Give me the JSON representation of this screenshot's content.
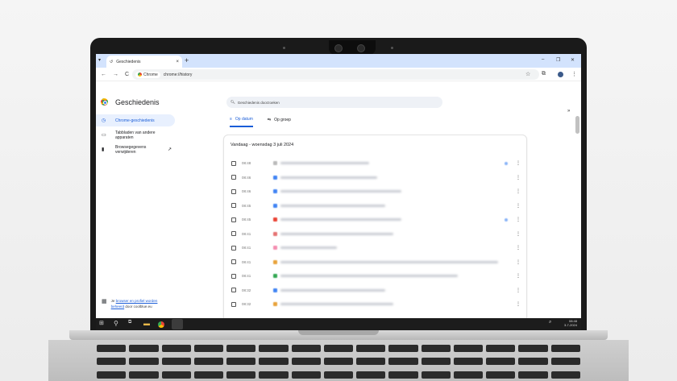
{
  "browser": {
    "tab_title": "Geschiedenis",
    "tab_icon": "history-icon",
    "new_tab": "+",
    "url_chip": "Chrome",
    "url": "chrome://history"
  },
  "sidebar": {
    "title": "Geschiedenis",
    "items": [
      {
        "label": "Chrome-geschiedenis",
        "icon": "history-icon",
        "active": true
      },
      {
        "label": "Tabbladen van andere apparaten",
        "icon": "devices-icon",
        "active": false
      },
      {
        "label": "Browsegegevens verwijderen",
        "icon": "trash-icon",
        "active": false
      }
    ],
    "managed_prefix": "Je",
    "managed_link1": "browser en profiel worden",
    "managed_link2": "beheerd",
    "managed_suffix": "door coolblue.eu"
  },
  "main": {
    "search_placeholder": "Geschiedenis doorzoeken",
    "tabs": [
      {
        "label": "Op datum",
        "active": true
      },
      {
        "label": "Op groep",
        "active": false
      }
    ],
    "card_header": "Vandaag - woensdag 3 juli 2024",
    "rows": [
      {
        "time": "08:48"
      },
      {
        "time": "08:46"
      },
      {
        "time": "08:46"
      },
      {
        "time": "08:45"
      },
      {
        "time": "08:45"
      },
      {
        "time": "08:41"
      },
      {
        "time": "08:41"
      },
      {
        "time": "08:41"
      },
      {
        "time": "08:41"
      },
      {
        "time": "08:32"
      },
      {
        "time": "08:32"
      }
    ]
  },
  "taskbar": {
    "time": "08:48",
    "date": "3-7-2024"
  }
}
